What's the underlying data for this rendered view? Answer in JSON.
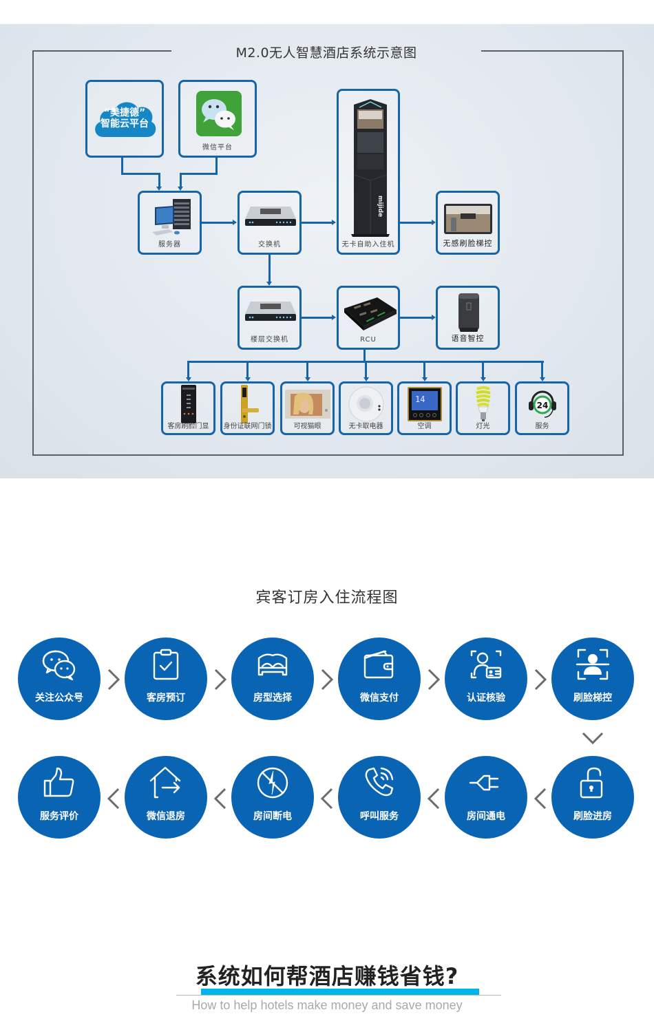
{
  "system_diagram": {
    "title": "M2.0无人智慧酒店系统示意图",
    "cloud_platform": {
      "line1": "“美捷德”",
      "line2": "智能云平台"
    },
    "nodes": {
      "wechat": "微信平台",
      "server": "服务器",
      "switch": "交换机",
      "kiosk": "无卡自助入住机",
      "kiosk_brand": "mijide",
      "elevator": "无感刷脸梯控",
      "floor_switch": "楼层交换机",
      "rcu": "RCU",
      "voice": "语音智控"
    },
    "devices": [
      {
        "label": "客房刷脸门显",
        "icon": "door-display-icon"
      },
      {
        "label": "身份证联网门锁",
        "icon": "door-lock-icon"
      },
      {
        "label": "可视猫眼",
        "icon": "video-peephole-icon"
      },
      {
        "label": "无卡取电器",
        "icon": "power-switch-icon"
      },
      {
        "label": "空调",
        "icon": "thermostat-icon",
        "display": "14"
      },
      {
        "label": "灯光",
        "icon": "light-bulb-icon"
      },
      {
        "label": "服务",
        "icon": "service-24h-icon",
        "badge": "24"
      }
    ]
  },
  "flow": {
    "title": "宾客订房入住流程图",
    "row1": [
      {
        "label": "关注公众号",
        "icon": "wechat-icon"
      },
      {
        "label": "客房预订",
        "icon": "clipboard-check-icon"
      },
      {
        "label": "房型选择",
        "icon": "bed-icon"
      },
      {
        "label": "微信支付",
        "icon": "wallet-icon"
      },
      {
        "label": "认证核验",
        "icon": "id-verify-icon"
      },
      {
        "label": "刷脸梯控",
        "icon": "face-scan-icon"
      }
    ],
    "row2": [
      {
        "label": "服务评价",
        "icon": "thumbs-up-icon"
      },
      {
        "label": "微信退房",
        "icon": "house-exit-icon"
      },
      {
        "label": "房间断电",
        "icon": "power-off-icon"
      },
      {
        "label": "呼叫服务",
        "icon": "phone-call-icon"
      },
      {
        "label": "房间通电",
        "icon": "plug-icon"
      },
      {
        "label": "刷脸进房",
        "icon": "unlock-icon"
      }
    ]
  },
  "money_section": {
    "title": "系统如何帮酒店赚钱省钱?",
    "subtitle": "How to help hotels make money and save money",
    "accent_color": "#00b4ec"
  },
  "colors": {
    "node_border": "#1565a8",
    "step_circle": "#0a64b4",
    "chevron": "#6b6b6b"
  }
}
